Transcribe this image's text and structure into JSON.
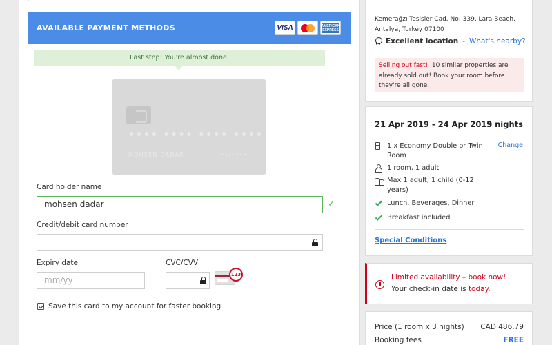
{
  "payment": {
    "header_title": "AVAILABLE PAYMENT METHODS",
    "logos": {
      "visa": "VISA",
      "mastercard_icon": "mastercard-logo-icon",
      "amex": "AMERICAN EXPRESS"
    },
    "step_message": "Last step! You're almost done.",
    "card_preview": {
      "number": "•••• •••• •••• ••••",
      "holder": "MOHSEN DADAR",
      "expiry": "••/••••"
    },
    "holder_label": "Card holder name",
    "holder_value": "mohsen dadar",
    "number_label": "Credit/debit card number",
    "number_value": "",
    "expiry_label": "Expiry date",
    "expiry_placeholder": "mm/yy",
    "cvc_label": "CVC/CVV",
    "cvc_badge": "123",
    "save_card_label": "Save this card to my account for faster booking",
    "save_card_checked": true
  },
  "hotel": {
    "address": "Kemerağzı Tesisler Cad. No: 339, Lara Beach, Antalya, Turkey 07100",
    "location_label": "Excellent location",
    "location_separator": " - ",
    "location_link": "What's nearby?",
    "sellout_title": "Selling out fast!",
    "sellout_text": "10 similar properties are already sold out! Book your room before they're all gone."
  },
  "booking": {
    "dates": "21 Apr 2019 - 24 Apr 2019",
    "nights": "3 nights",
    "room": "1 x Economy Double or Twin Room",
    "change_link": "Change",
    "rooms_adults": "1 room, 1 adult",
    "max_occupancy": "Max 1 adult, 1 child (0-12 years)",
    "meals": "Lunch, Beverages, Dinner",
    "breakfast": "Breakfast included",
    "special_conditions": "Special Conditions"
  },
  "availability": {
    "title": "Limited availability – book now!",
    "subtitle_prefix": "Your check-in date is ",
    "subtitle_highlight": "today",
    "subtitle_suffix": "."
  },
  "pricing": {
    "price_label": "Price (1 room x 3 nights)",
    "price_value": "CAD 486.79",
    "fees_label": "Booking fees",
    "fees_value": "FREE"
  },
  "colors": {
    "accent_blue": "#4a8ce6",
    "link_blue": "#2a72d8",
    "alert_red": "#d0021b",
    "success_green": "#5cb85c"
  }
}
